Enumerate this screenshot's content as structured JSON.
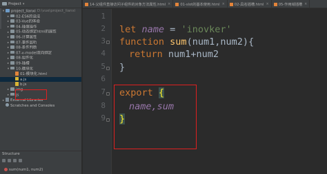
{
  "project_panel": {
    "title": "Project",
    "tree": [
      {
        "depth": 0,
        "arrow": "▾",
        "icon": "folder-blue",
        "label": "project_lianxi",
        "hint": "D:\\vue\\project_lianxi"
      },
      {
        "depth": 1,
        "arrow": "▸",
        "icon": "folder",
        "label": "02-ES6的语法",
        "hint": ""
      },
      {
        "depth": 1,
        "arrow": "▸",
        "icon": "folder",
        "label": "03-Vue的体验",
        "hint": ""
      },
      {
        "depth": 1,
        "arrow": "▸",
        "icon": "folder",
        "label": "04-插值操作",
        "hint": ""
      },
      {
        "depth": 1,
        "arrow": "▸",
        "icon": "folder",
        "label": "05-动态绑定html的属性",
        "hint": ""
      },
      {
        "depth": 1,
        "arrow": "▸",
        "icon": "folder",
        "label": "06-计算属性",
        "hint": ""
      },
      {
        "depth": 1,
        "arrow": "▸",
        "icon": "folder",
        "label": "07-事件监听",
        "hint": ""
      },
      {
        "depth": 1,
        "arrow": "▸",
        "icon": "folder",
        "label": "08-条件判断",
        "hint": ""
      },
      {
        "depth": 1,
        "arrow": "▸",
        "icon": "folder",
        "label": "07-v-model双向绑定",
        "hint": ""
      },
      {
        "depth": 1,
        "arrow": "▸",
        "icon": "folder",
        "label": "08-组件化",
        "hint": ""
      },
      {
        "depth": 1,
        "arrow": "▸",
        "icon": "folder",
        "label": "09-插槽",
        "hint": ""
      },
      {
        "depth": 1,
        "arrow": "▾",
        "icon": "folder",
        "label": "10-模块化",
        "hint": ""
      },
      {
        "depth": 2,
        "arrow": "",
        "icon": "html",
        "label": "01-模块化.html",
        "hint": ""
      },
      {
        "depth": 2,
        "arrow": "",
        "icon": "js",
        "label": "a.js",
        "hint": "",
        "selected": true
      },
      {
        "depth": 2,
        "arrow": "",
        "icon": "js",
        "label": "b.js",
        "hint": ""
      },
      {
        "depth": 1,
        "arrow": "▸",
        "icon": "folder",
        "label": "img",
        "hint": ""
      },
      {
        "depth": 1,
        "arrow": "▸",
        "icon": "folder",
        "label": "js",
        "hint": ""
      },
      {
        "depth": 0,
        "arrow": "▸",
        "icon": "lib",
        "label": "External Libraries",
        "hint": ""
      },
      {
        "depth": 0,
        "arrow": "",
        "icon": "scratch",
        "label": "Scratches and Consoles",
        "hint": ""
      }
    ]
  },
  "structure_panel": {
    "title": "Structure",
    "item": "sum(num1, num2)"
  },
  "tabs": [
    {
      "label": "14-父组件直接访问子组件的对象方法属性.html",
      "type": "html",
      "active": false
    },
    {
      "label": "01-slot的基本使用.html",
      "type": "html",
      "active": false
    },
    {
      "label": "02-具名插槽.html",
      "type": "html",
      "active": false
    },
    {
      "label": "05-作用域插槽",
      "type": "html",
      "active": false
    }
  ],
  "editor": {
    "line_numbers": [
      "1",
      "2",
      "3",
      "4",
      "5",
      "6",
      "7",
      "8",
      "9"
    ],
    "code": {
      "l2_kw": "let",
      "l2_var": "name",
      "l2_eq": " = ",
      "l2_str": "'inovker'",
      "l3_kw": "function",
      "l3_fn": "sum",
      "l3_rest": "(num1,num2){",
      "l4_kw": "return",
      "l4_rest": " num1+num2",
      "l5": "}",
      "l7_kw": "export",
      "l7_brace": "{",
      "l8": "name,sum",
      "l9": "}"
    }
  },
  "colors": {
    "annotation_red": "#e02020",
    "keyword": "#cc7832",
    "string": "#6a8759",
    "function": "#ffc66d",
    "variable": "#9876aa"
  }
}
